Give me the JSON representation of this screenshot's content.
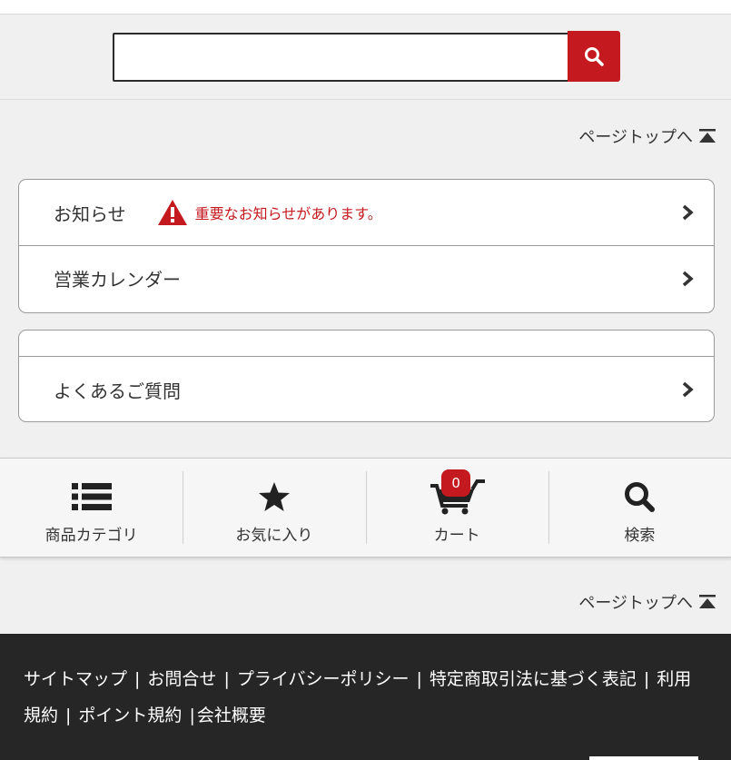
{
  "search": {
    "value": "",
    "placeholder": ""
  },
  "icons": {
    "search": "search-icon",
    "chevron": "chevron-right-icon",
    "warning": "warning-triangle-icon",
    "pagetop": "arrow-up-bar-icon"
  },
  "pagetop_label": "ページトップへ",
  "info_card": {
    "items": [
      {
        "label": "お知らせ",
        "alert": "重要なお知らせがあります。"
      },
      {
        "label": "営業カレンダー"
      }
    ]
  },
  "faq_card": {
    "label": "よくあるご質問"
  },
  "bottom_nav": {
    "items": [
      {
        "label": "商品カテゴリ",
        "icon": "list-icon"
      },
      {
        "label": "お気に入り",
        "icon": "star-icon"
      },
      {
        "label": "カート",
        "icon": "cart-icon",
        "badge": "0"
      },
      {
        "label": "検索",
        "icon": "search-icon"
      }
    ]
  },
  "footer": {
    "links": [
      "サイトマップ",
      "お問合せ",
      "プライバシーポリシー",
      "特定商取引法に基づく表記",
      "利用規約",
      "ポイント規約",
      "会社概要"
    ],
    "separator": "|"
  },
  "colors": {
    "accent": "#c41a1f",
    "footer_bg": "#262626",
    "page_bg": "#f0f0f0"
  }
}
